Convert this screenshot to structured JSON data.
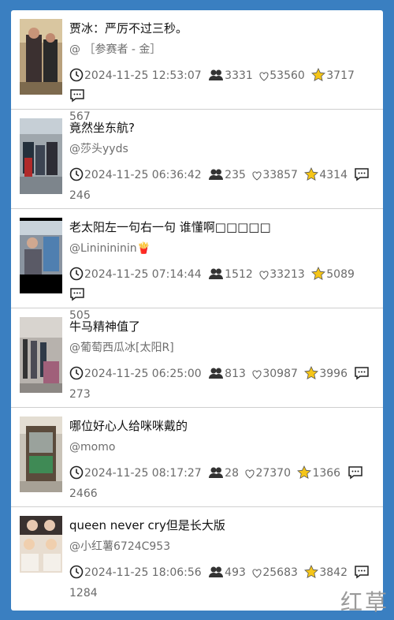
{
  "posts": [
    {
      "title": "贾冰：严厉不过三秒。",
      "author": "@ ［参赛者 - 金］",
      "date": "2024-11-25 12:53:07",
      "views": "3331",
      "likes": "53560",
      "stars": "3717",
      "comments": "567"
    },
    {
      "title": "竟然坐东航?",
      "author": "@莎头yyds",
      "date": "2024-11-25 06:36:42",
      "views": "235",
      "likes": "33857",
      "stars": "4314",
      "comments": "246"
    },
    {
      "title": "老太阳左一句右一句 谁懂啊□□□□□",
      "author": "@Lininininin🍟",
      "date": "2024-11-25 07:14:44",
      "views": "1512",
      "likes": "33213",
      "stars": "5089",
      "comments": "505"
    },
    {
      "title": "牛马精神值了",
      "author": "@葡萄西瓜冰[太阳R]",
      "date": "2024-11-25 06:25:00",
      "views": "813",
      "likes": "30987",
      "stars": "3996",
      "comments": "273"
    },
    {
      "title": "哪位好心人给咪咪戴的",
      "author": "@momo",
      "date": "2024-11-25 08:17:27",
      "views": "28",
      "likes": "27370",
      "stars": "1366",
      "comments": "2466"
    },
    {
      "title": "queen never cry但是长大版",
      "author": "@小红薯6724C953",
      "date": "2024-11-25 18:06:56",
      "views": "493",
      "likes": "25683",
      "stars": "3842",
      "comments": "1284"
    }
  ],
  "watermark": "红草",
  "colors": {
    "background": "#3a7fc1",
    "star": "#f5c518",
    "text_muted": "#6a6a6a"
  }
}
